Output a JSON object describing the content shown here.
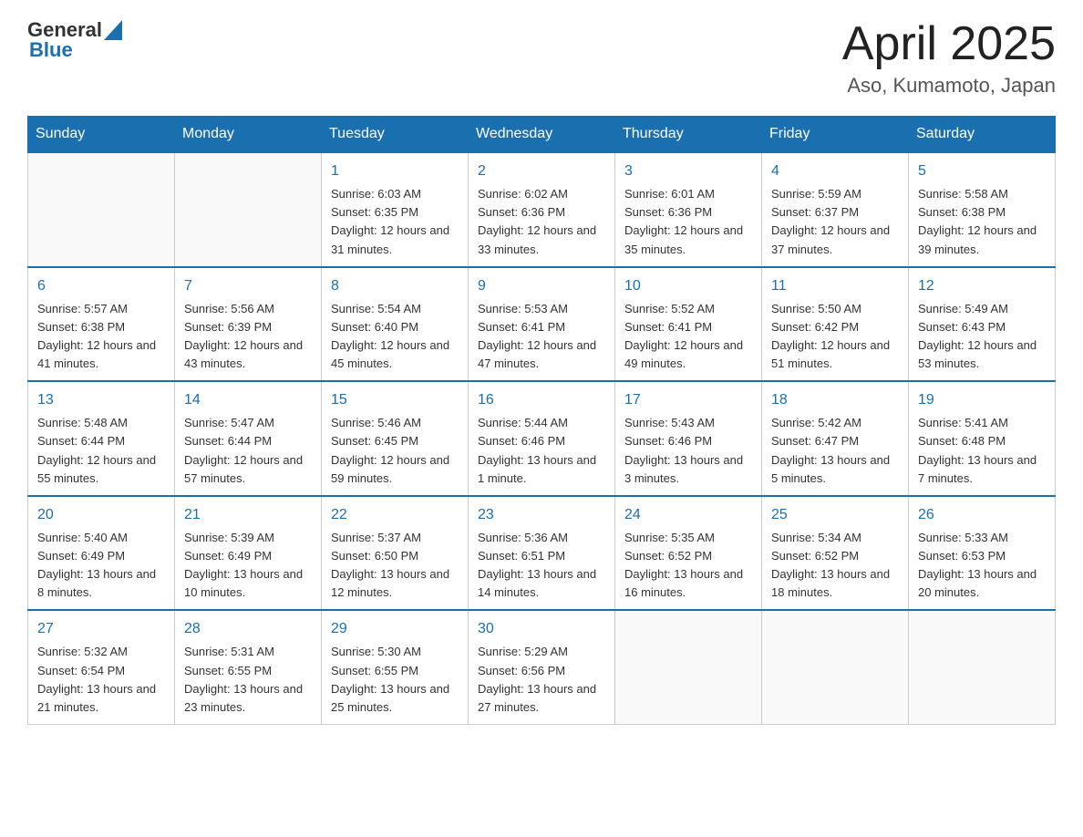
{
  "header": {
    "logo_general": "General",
    "logo_blue": "Blue",
    "title": "April 2025",
    "subtitle": "Aso, Kumamoto, Japan"
  },
  "weekdays": [
    "Sunday",
    "Monday",
    "Tuesday",
    "Wednesday",
    "Thursday",
    "Friday",
    "Saturday"
  ],
  "weeks": [
    [
      {
        "day": "",
        "sunrise": "",
        "sunset": "",
        "daylight": ""
      },
      {
        "day": "",
        "sunrise": "",
        "sunset": "",
        "daylight": ""
      },
      {
        "day": "1",
        "sunrise": "Sunrise: 6:03 AM",
        "sunset": "Sunset: 6:35 PM",
        "daylight": "Daylight: 12 hours and 31 minutes."
      },
      {
        "day": "2",
        "sunrise": "Sunrise: 6:02 AM",
        "sunset": "Sunset: 6:36 PM",
        "daylight": "Daylight: 12 hours and 33 minutes."
      },
      {
        "day": "3",
        "sunrise": "Sunrise: 6:01 AM",
        "sunset": "Sunset: 6:36 PM",
        "daylight": "Daylight: 12 hours and 35 minutes."
      },
      {
        "day": "4",
        "sunrise": "Sunrise: 5:59 AM",
        "sunset": "Sunset: 6:37 PM",
        "daylight": "Daylight: 12 hours and 37 minutes."
      },
      {
        "day": "5",
        "sunrise": "Sunrise: 5:58 AM",
        "sunset": "Sunset: 6:38 PM",
        "daylight": "Daylight: 12 hours and 39 minutes."
      }
    ],
    [
      {
        "day": "6",
        "sunrise": "Sunrise: 5:57 AM",
        "sunset": "Sunset: 6:38 PM",
        "daylight": "Daylight: 12 hours and 41 minutes."
      },
      {
        "day": "7",
        "sunrise": "Sunrise: 5:56 AM",
        "sunset": "Sunset: 6:39 PM",
        "daylight": "Daylight: 12 hours and 43 minutes."
      },
      {
        "day": "8",
        "sunrise": "Sunrise: 5:54 AM",
        "sunset": "Sunset: 6:40 PM",
        "daylight": "Daylight: 12 hours and 45 minutes."
      },
      {
        "day": "9",
        "sunrise": "Sunrise: 5:53 AM",
        "sunset": "Sunset: 6:41 PM",
        "daylight": "Daylight: 12 hours and 47 minutes."
      },
      {
        "day": "10",
        "sunrise": "Sunrise: 5:52 AM",
        "sunset": "Sunset: 6:41 PM",
        "daylight": "Daylight: 12 hours and 49 minutes."
      },
      {
        "day": "11",
        "sunrise": "Sunrise: 5:50 AM",
        "sunset": "Sunset: 6:42 PM",
        "daylight": "Daylight: 12 hours and 51 minutes."
      },
      {
        "day": "12",
        "sunrise": "Sunrise: 5:49 AM",
        "sunset": "Sunset: 6:43 PM",
        "daylight": "Daylight: 12 hours and 53 minutes."
      }
    ],
    [
      {
        "day": "13",
        "sunrise": "Sunrise: 5:48 AM",
        "sunset": "Sunset: 6:44 PM",
        "daylight": "Daylight: 12 hours and 55 minutes."
      },
      {
        "day": "14",
        "sunrise": "Sunrise: 5:47 AM",
        "sunset": "Sunset: 6:44 PM",
        "daylight": "Daylight: 12 hours and 57 minutes."
      },
      {
        "day": "15",
        "sunrise": "Sunrise: 5:46 AM",
        "sunset": "Sunset: 6:45 PM",
        "daylight": "Daylight: 12 hours and 59 minutes."
      },
      {
        "day": "16",
        "sunrise": "Sunrise: 5:44 AM",
        "sunset": "Sunset: 6:46 PM",
        "daylight": "Daylight: 13 hours and 1 minute."
      },
      {
        "day": "17",
        "sunrise": "Sunrise: 5:43 AM",
        "sunset": "Sunset: 6:46 PM",
        "daylight": "Daylight: 13 hours and 3 minutes."
      },
      {
        "day": "18",
        "sunrise": "Sunrise: 5:42 AM",
        "sunset": "Sunset: 6:47 PM",
        "daylight": "Daylight: 13 hours and 5 minutes."
      },
      {
        "day": "19",
        "sunrise": "Sunrise: 5:41 AM",
        "sunset": "Sunset: 6:48 PM",
        "daylight": "Daylight: 13 hours and 7 minutes."
      }
    ],
    [
      {
        "day": "20",
        "sunrise": "Sunrise: 5:40 AM",
        "sunset": "Sunset: 6:49 PM",
        "daylight": "Daylight: 13 hours and 8 minutes."
      },
      {
        "day": "21",
        "sunrise": "Sunrise: 5:39 AM",
        "sunset": "Sunset: 6:49 PM",
        "daylight": "Daylight: 13 hours and 10 minutes."
      },
      {
        "day": "22",
        "sunrise": "Sunrise: 5:37 AM",
        "sunset": "Sunset: 6:50 PM",
        "daylight": "Daylight: 13 hours and 12 minutes."
      },
      {
        "day": "23",
        "sunrise": "Sunrise: 5:36 AM",
        "sunset": "Sunset: 6:51 PM",
        "daylight": "Daylight: 13 hours and 14 minutes."
      },
      {
        "day": "24",
        "sunrise": "Sunrise: 5:35 AM",
        "sunset": "Sunset: 6:52 PM",
        "daylight": "Daylight: 13 hours and 16 minutes."
      },
      {
        "day": "25",
        "sunrise": "Sunrise: 5:34 AM",
        "sunset": "Sunset: 6:52 PM",
        "daylight": "Daylight: 13 hours and 18 minutes."
      },
      {
        "day": "26",
        "sunrise": "Sunrise: 5:33 AM",
        "sunset": "Sunset: 6:53 PM",
        "daylight": "Daylight: 13 hours and 20 minutes."
      }
    ],
    [
      {
        "day": "27",
        "sunrise": "Sunrise: 5:32 AM",
        "sunset": "Sunset: 6:54 PM",
        "daylight": "Daylight: 13 hours and 21 minutes."
      },
      {
        "day": "28",
        "sunrise": "Sunrise: 5:31 AM",
        "sunset": "Sunset: 6:55 PM",
        "daylight": "Daylight: 13 hours and 23 minutes."
      },
      {
        "day": "29",
        "sunrise": "Sunrise: 5:30 AM",
        "sunset": "Sunset: 6:55 PM",
        "daylight": "Daylight: 13 hours and 25 minutes."
      },
      {
        "day": "30",
        "sunrise": "Sunrise: 5:29 AM",
        "sunset": "Sunset: 6:56 PM",
        "daylight": "Daylight: 13 hours and 27 minutes."
      },
      {
        "day": "",
        "sunrise": "",
        "sunset": "",
        "daylight": ""
      },
      {
        "day": "",
        "sunrise": "",
        "sunset": "",
        "daylight": ""
      },
      {
        "day": "",
        "sunrise": "",
        "sunset": "",
        "daylight": ""
      }
    ]
  ]
}
